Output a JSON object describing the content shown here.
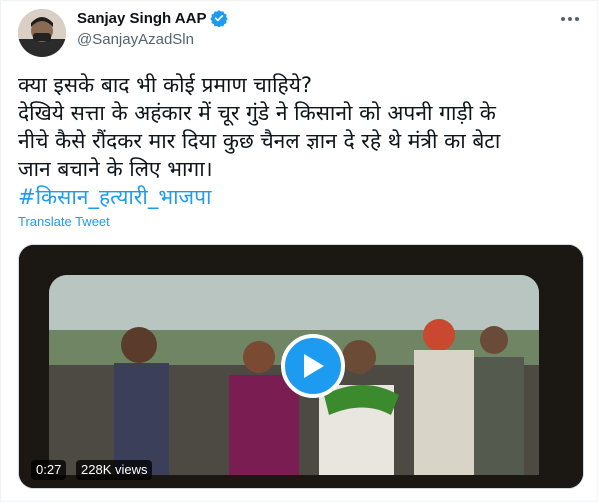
{
  "author": {
    "name": "Sanjay Singh AAP",
    "handle": "@SanjayAzadSln",
    "verified": true
  },
  "tweet": {
    "lines": [
      "क्या इसके बाद भी कोई प्रमाण चाहिये?",
      "देखिये सत्ता के अहंकार में चूर गुंडे ने किसानो को अपनी गाड़ी के",
      "नीचे कैसे रौंदकर मार दिया कुछ चैनल ज्ञान दे रहे थे मंत्री का बेटा",
      "जान बचाने के लिए भागा।"
    ],
    "hashtag": "#किसान_हत्यारी_भाजपा",
    "translate_label": "Translate Tweet"
  },
  "video": {
    "duration": "0:27",
    "views": "228K views"
  },
  "icons": {
    "more": "more-icon",
    "verified": "verified-badge-icon",
    "play": "play-icon"
  },
  "colors": {
    "accent": "#1d9bf0",
    "text": "#0f1419",
    "muted": "#536471"
  }
}
